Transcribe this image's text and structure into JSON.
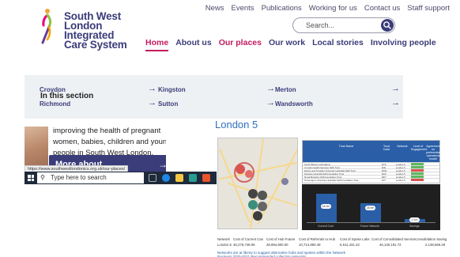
{
  "logo": {
    "line1": "South West",
    "line2": "London",
    "line3": "Integrated",
    "line4": "Care System"
  },
  "topnav": [
    "News",
    "Events",
    "Publications",
    "Working for us",
    "Contact us",
    "Staff support"
  ],
  "search": {
    "placeholder": "Search..."
  },
  "mainnav": {
    "home": "Home",
    "about": "About us",
    "places": "Our places",
    "work": "Our work",
    "stories": "Local stories",
    "involving": "Involving people"
  },
  "section": {
    "heading": "In this section",
    "links": [
      "Croydon",
      "Kingston",
      "Merton",
      "Richmond",
      "Sutton",
      "Wandsworth"
    ],
    "arrow": "→"
  },
  "card": {
    "text": "improving the health of pregnant women, babies, children and young people in South West London.",
    "more_label": "More about",
    "more_arrow": "→"
  },
  "status_url": "https://www.southwestlondonics.org.uk/our-places/",
  "taskbar": {
    "search_text": "Type here to search"
  },
  "doc": {
    "title": "London 5",
    "table_headers": [
      "Trust Name",
      "Trust Code",
      "Network",
      "Level of Engagement",
      "Agreement on preferential operations model"
    ],
    "table_rows": [
      [
        "South Western Ambulance",
        "RYF",
        "London 5"
      ],
      [
        "Croydon Health Services NHS Trust",
        "RJ6",
        "London 5"
      ],
      [
        "Epsom and St Helier University Hospitals NHS Trust",
        "RVR",
        "London 5"
      ],
      [
        "Kingston Hospital NHS Foundation Trust",
        "RAX",
        "London 5"
      ],
      [
        "Royal Marsden NHS Foundation Trust",
        "RPY",
        "London 5"
      ],
      [
        "St George's University Hospitals NHS Foundation Trust",
        "RJ7",
        "London 5"
      ]
    ],
    "bar_categories": [
      "Current Cost",
      "Future Network",
      "Savings"
    ],
    "bar_values": [
      "46.2m",
      "28.9m",
      "2.1m"
    ],
    "summary_headers": [
      "Network",
      "Cost of Current Cas",
      "Cost of Hub Future",
      "Cost of Referrals to Hub",
      "Cost of Spoke Labs",
      "Cost of Consolidated Service",
      "Consolidation Saving"
    ],
    "summary_values": [
      "London 5",
      "46,278,748.06",
      "28,994,800.00",
      "10,714,950.48",
      "6,511,431.23",
      "46,140,181.72",
      "2,138,566.28"
    ],
    "footnote": "Networks are at liberty to suggest alternative hubs and spokes within the Network Business 2020-2021 Recommended collection networks"
  },
  "colors": {
    "brand": "#3b3c7a",
    "accent": "#c31b5e",
    "doc_blue": "#2a5fa8"
  }
}
